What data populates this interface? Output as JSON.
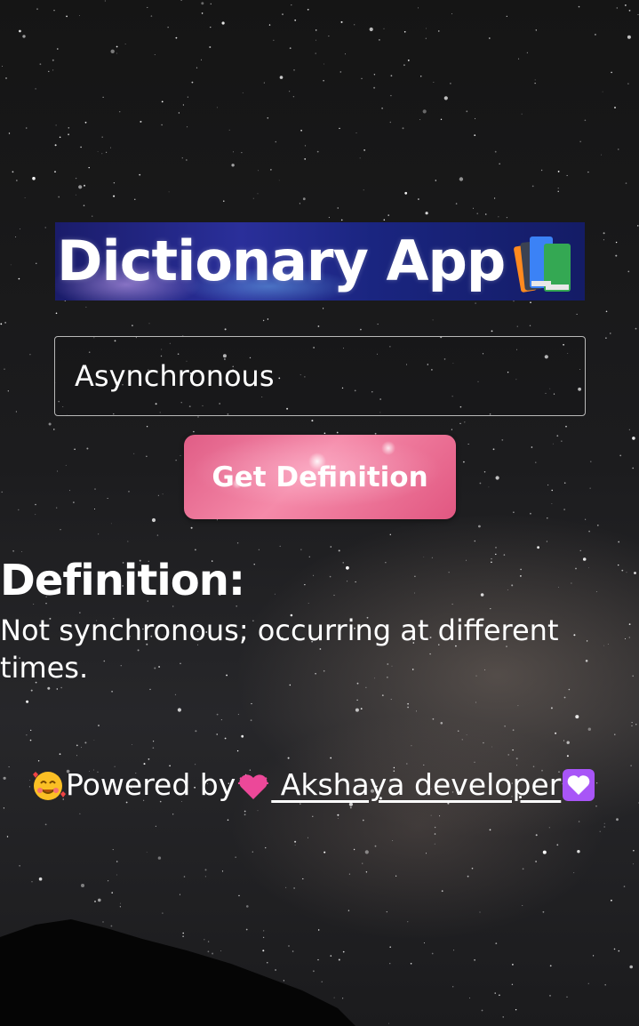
{
  "app": {
    "title": "Dictionary App",
    "title_icon": "books-emoji-icon"
  },
  "search": {
    "value": "Asynchronous"
  },
  "actions": {
    "get_definition_label": "Get Definition"
  },
  "result": {
    "heading": "Definition:",
    "text": "Not synchronous; occurring at different times."
  },
  "footer": {
    "leading_icon": "smiling-face-with-hearts-icon",
    "prefix": "Powered by ",
    "link_text": " Akshaya developer ",
    "link_leading_icon": "beating-heart-icon",
    "trailing_icon": "white-heart-icon"
  },
  "colors": {
    "banner_blue": "#1a2580",
    "button_pink": "#e05d86",
    "input_border": "#b9b9b9",
    "text": "#ffffff"
  }
}
